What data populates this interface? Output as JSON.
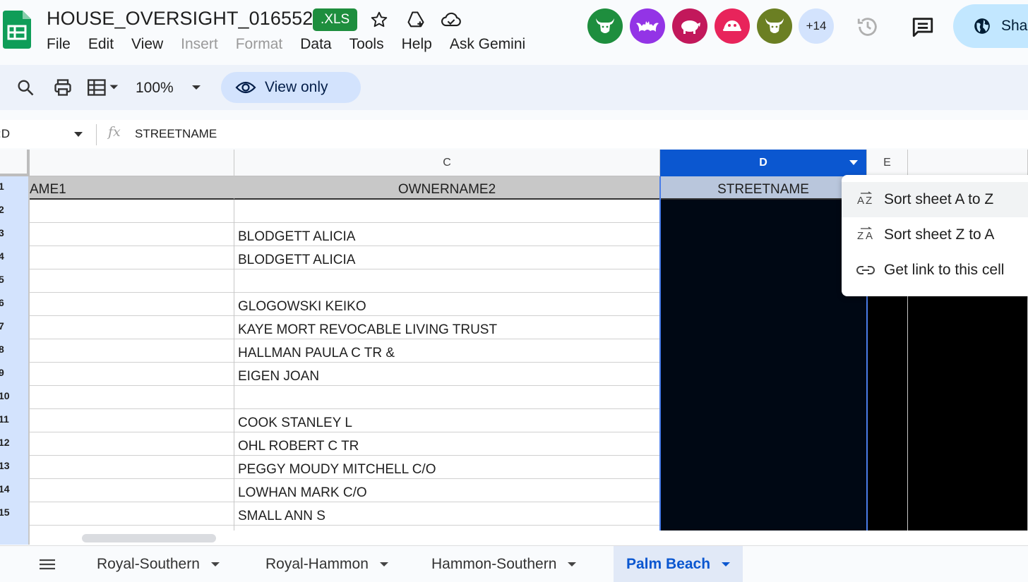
{
  "app": {
    "doc_title": "HOUSE_OVERSIGHT_016552",
    "file_badge": ".XLS",
    "menus": [
      "File",
      "Edit",
      "View",
      "Insert",
      "Format",
      "Data",
      "Tools",
      "Help",
      "Ask Gemini"
    ],
    "disabled_menus": [
      "Insert",
      "Format"
    ],
    "collaborators_more": "+14",
    "share_label": "Sha"
  },
  "toolbar": {
    "zoom": "100%",
    "view_only_label": "View only"
  },
  "formula_bar": {
    "name_box": ":D",
    "value": "STREETNAME"
  },
  "grid": {
    "columns": [
      "C",
      "D",
      "E"
    ],
    "selected_column": "D",
    "header_row": {
      "row_num": "1",
      "col_b": "AME1",
      "col_c": "OWNERNAME2",
      "col_d": "STREETNAME"
    },
    "rows": [
      {
        "num": "2",
        "c": ""
      },
      {
        "num": "3",
        "c": "BLODGETT ALICIA"
      },
      {
        "num": "4",
        "c": "BLODGETT ALICIA"
      },
      {
        "num": "5",
        "c": ""
      },
      {
        "num": "6",
        "c": "GLOGOWSKI KEIKO"
      },
      {
        "num": "7",
        "c": "KAYE MORT REVOCABLE LIVING TRUST"
      },
      {
        "num": "8",
        "c": "HALLMAN PAULA C TR &"
      },
      {
        "num": "9",
        "c": "EIGEN JOAN"
      },
      {
        "num": "10",
        "c": ""
      },
      {
        "num": "11",
        "c": "COOK STANLEY L"
      },
      {
        "num": "12",
        "c": "OHL ROBERT C TR"
      },
      {
        "num": "13",
        "c": "PEGGY MOUDY MITCHELL C/O"
      },
      {
        "num": "14",
        "c": "LOWHAN MARK C/O"
      },
      {
        "num": "15",
        "c": "SMALL ANN S"
      }
    ]
  },
  "context_menu": {
    "items": [
      {
        "label": "Sort sheet A to Z",
        "icon": "sort-a-z-icon"
      },
      {
        "label": "Sort sheet Z to A",
        "icon": "sort-z-a-icon"
      },
      {
        "label": "Get link to this cell",
        "icon": "link-icon"
      }
    ]
  },
  "sheet_tabs": {
    "tabs": [
      "Royal-Southern",
      "Royal-Hammon",
      "Hammon-Southern",
      "Palm Beach"
    ],
    "active": "Palm Beach"
  },
  "colors": {
    "accent_blue": "#0b57d0",
    "sheets_green": "#0f9d58",
    "redacted_cell": "#000814"
  }
}
